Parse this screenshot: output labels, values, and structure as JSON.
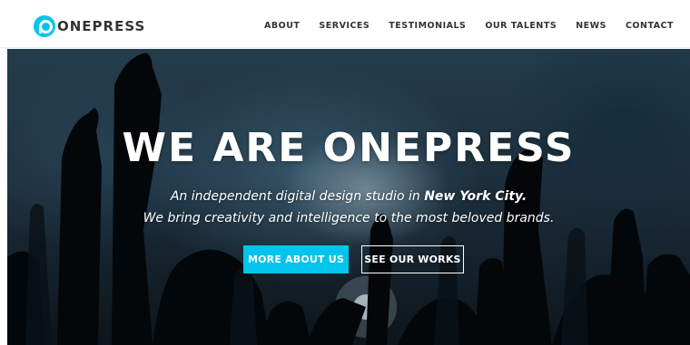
{
  "logo": {
    "icon": "onepress-p-logo-icon",
    "text": "ONEPRESS",
    "color": "#03c4eb"
  },
  "nav": {
    "items": [
      {
        "label": "ABOUT"
      },
      {
        "label": "SERVICES"
      },
      {
        "label": "TESTIMONIALS"
      },
      {
        "label": "OUR TALENTS"
      },
      {
        "label": "NEWS"
      },
      {
        "label": "CONTACT"
      }
    ]
  },
  "hero": {
    "title": "WE ARE ONEPRESS",
    "subtitle_line1_prefix": "An independent digital design studio in ",
    "subtitle_line1_emphasis": "New York City.",
    "subtitle_line2": "We bring creativity and intelligence to the most beloved brands.",
    "primary_button": "MORE ABOUT US",
    "secondary_button": "SEE OUR WORKS",
    "accent_color": "#03c4eb"
  }
}
